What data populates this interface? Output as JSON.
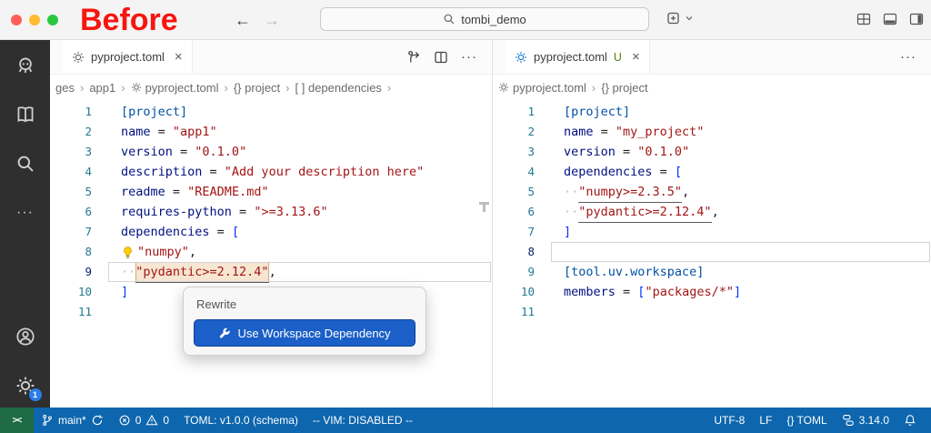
{
  "colors": {
    "titlebar_bg": "#f4f4f4",
    "activity_bg": "#2f2f2f",
    "status_bg": "#0d66ae",
    "remote_bg": "#1f6b45",
    "annotation_red": "#f8150f",
    "button_bg": "#1b5fc8",
    "button_border": "#0d439a",
    "badge_bg": "#2b7de9",
    "sec_blue": "#0451a5",
    "key_blue": "#001080",
    "str_red": "#a31515",
    "br_blue": "#0431fa",
    "linenum": "#237893",
    "linenum_active": "#0b216f",
    "git_untracked": "#587c0c",
    "mac_red": "#ff5f57",
    "mac_yellow": "#febc2e",
    "mac_green": "#2ac840"
  },
  "icons": {
    "back": "←",
    "forward": "→",
    "close": "×",
    "more": "···",
    "crumb_sep": "›",
    "remote": "><"
  },
  "titlebar": {
    "annotation": "Before",
    "search": "tombi_demo"
  },
  "activity_bar": {
    "settings_badge": "1"
  },
  "tabs": {
    "left": {
      "label": "pyproject.toml"
    },
    "right": {
      "label": "pyproject.toml",
      "git_status": "U"
    }
  },
  "breadcrumbs": {
    "left": [
      {
        "label": "ges"
      },
      {
        "label": "app1"
      },
      {
        "icon": "gear",
        "label": "pyproject.toml"
      },
      {
        "label": "{} project"
      },
      {
        "label": "[ ] dependencies"
      }
    ],
    "left_trailing": true,
    "right": [
      {
        "icon": "gear",
        "label": "pyproject.toml"
      },
      {
        "label": "{} project"
      }
    ]
  },
  "editors": {
    "left": {
      "lines": [
        {
          "tokens": [
            {
              "t": "[project]",
              "c": "sec"
            }
          ]
        },
        {
          "tokens": [
            {
              "t": "name",
              "c": "key"
            },
            {
              "t": " = ",
              "c": "op"
            },
            {
              "t": "\"app1\"",
              "c": "str"
            }
          ]
        },
        {
          "tokens": [
            {
              "t": "version",
              "c": "key"
            },
            {
              "t": " = ",
              "c": "op"
            },
            {
              "t": "\"0.1.0\"",
              "c": "str"
            }
          ]
        },
        {
          "tokens": [
            {
              "t": "description",
              "c": "key"
            },
            {
              "t": " = ",
              "c": "op"
            },
            {
              "t": "\"Add your description here\"",
              "c": "str"
            }
          ]
        },
        {
          "tokens": [
            {
              "t": "readme",
              "c": "key"
            },
            {
              "t": " = ",
              "c": "op"
            },
            {
              "t": "\"README.md\"",
              "c": "str"
            }
          ]
        },
        {
          "tokens": [
            {
              "t": "requires-python",
              "c": "key"
            },
            {
              "t": " = ",
              "c": "op"
            },
            {
              "t": "\">=3.13.6\"",
              "c": "str"
            }
          ]
        },
        {
          "tokens": [
            {
              "t": "dependencies",
              "c": "key"
            },
            {
              "t": " = ",
              "c": "op"
            },
            {
              "t": "[",
              "c": "br"
            }
          ]
        },
        {
          "bulb": true,
          "tokens": [
            {
              "t": "\"numpy\"",
              "c": "str uline"
            },
            {
              "t": ",",
              "c": "op"
            }
          ]
        },
        {
          "current": true,
          "tokens": [
            {
              "t": "··",
              "c": "ws"
            },
            {
              "t": "\"pydantic>=2.12.4\"",
              "c": "str hl"
            },
            {
              "t": ",",
              "c": "op"
            }
          ]
        },
        {
          "tokens": [
            {
              "t": "]",
              "c": "br"
            }
          ]
        },
        {
          "tokens": []
        }
      ]
    },
    "right": {
      "lines": [
        {
          "tokens": [
            {
              "t": "[project]",
              "c": "sec"
            }
          ]
        },
        {
          "tokens": [
            {
              "t": "name",
              "c": "key"
            },
            {
              "t": " = ",
              "c": "op"
            },
            {
              "t": "\"my_project\"",
              "c": "str"
            }
          ]
        },
        {
          "tokens": [
            {
              "t": "version",
              "c": "key"
            },
            {
              "t": " = ",
              "c": "op"
            },
            {
              "t": "\"0.1.0\"",
              "c": "str"
            }
          ]
        },
        {
          "tokens": [
            {
              "t": "dependencies",
              "c": "key"
            },
            {
              "t": " = ",
              "c": "op"
            },
            {
              "t": "[",
              "c": "br"
            }
          ]
        },
        {
          "tokens": [
            {
              "t": "··",
              "c": "ws"
            },
            {
              "t": "\"numpy>=2.3.5\"",
              "c": "str uline"
            },
            {
              "t": ",",
              "c": "op"
            }
          ]
        },
        {
          "tokens": [
            {
              "t": "··",
              "c": "ws"
            },
            {
              "t": "\"pydantic>=2.12.4\"",
              "c": "str uline"
            },
            {
              "t": ",",
              "c": "op"
            }
          ]
        },
        {
          "tokens": [
            {
              "t": "]",
              "c": "br"
            }
          ]
        },
        {
          "current": true,
          "tokens": []
        },
        {
          "tokens": [
            {
              "t": "[tool.uv.workspace]",
              "c": "sec"
            }
          ]
        },
        {
          "tokens": [
            {
              "t": "members",
              "c": "key"
            },
            {
              "t": " = ",
              "c": "op"
            },
            {
              "t": "[",
              "c": "br"
            },
            {
              "t": "\"packages/*\"",
              "c": "str"
            },
            {
              "t": "]",
              "c": "br"
            }
          ]
        },
        {
          "tokens": []
        }
      ]
    }
  },
  "popup": {
    "title": "Rewrite",
    "button": "Use Workspace Dependency"
  },
  "status_bar": {
    "branch": "main*",
    "errors": "0",
    "warnings": "0",
    "schema": "TOML: v1.0.0 (schema)",
    "vim": "-- VIM: DISABLED --",
    "encoding": "UTF-8",
    "eol": "LF",
    "language": "{} TOML",
    "python_version": "3.14.0"
  }
}
